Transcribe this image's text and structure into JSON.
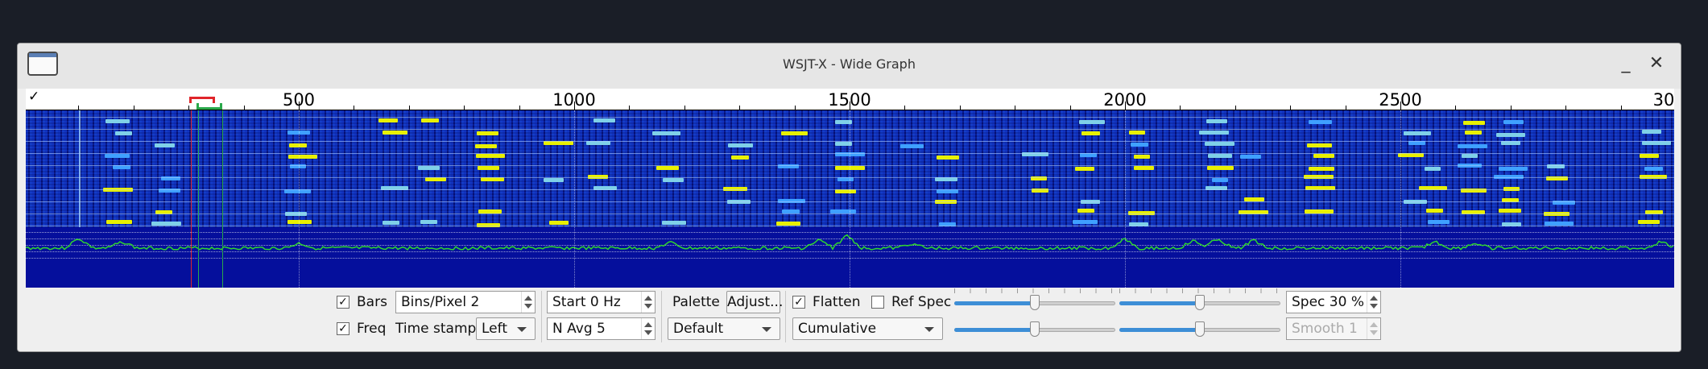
{
  "window": {
    "title": "WSJT-X - Wide Graph",
    "minimize_label": "_",
    "close_label": "✕",
    "app_icon": "window-icon"
  },
  "scale": {
    "check_glyph": "✓",
    "labels": [
      "500",
      "1000",
      "1500",
      "2000",
      "2500",
      "30"
    ]
  },
  "controls": {
    "bars": {
      "checked": true,
      "label": "Bars"
    },
    "freq": {
      "checked": true,
      "label": "Freq"
    },
    "bins_per_pixel": "Bins/Pixel  2",
    "timestamp_label": "Time stamp",
    "timestamp_value": "Left",
    "start": "Start 0 Hz",
    "navg": "N Avg 5",
    "palette_label": "Palette",
    "adjust_label": "Adjust...",
    "palette_value": "Default",
    "flatten": {
      "checked": true,
      "label": "Flatten"
    },
    "ref_spec": {
      "checked": false,
      "label": "Ref Spec"
    },
    "spectrum_value": "Cumulative",
    "spec_pct": "Spec 30 %",
    "smooth": "Smooth  1",
    "sliders": [
      {
        "name": "zero-slider",
        "level": 0.5
      },
      {
        "name": "gain-slider",
        "level": 0.5
      },
      {
        "name": "zero-slider-2",
        "level": 0.5
      },
      {
        "name": "gain-slider-2",
        "level": 0.5
      }
    ]
  },
  "colors": {
    "waterfall_bg": "#0a1aa8",
    "signal": "#e8f000",
    "spectrum_line": "#2fd52f",
    "rx_marker": "#2aa84a",
    "tx_marker": "#e0252a"
  }
}
